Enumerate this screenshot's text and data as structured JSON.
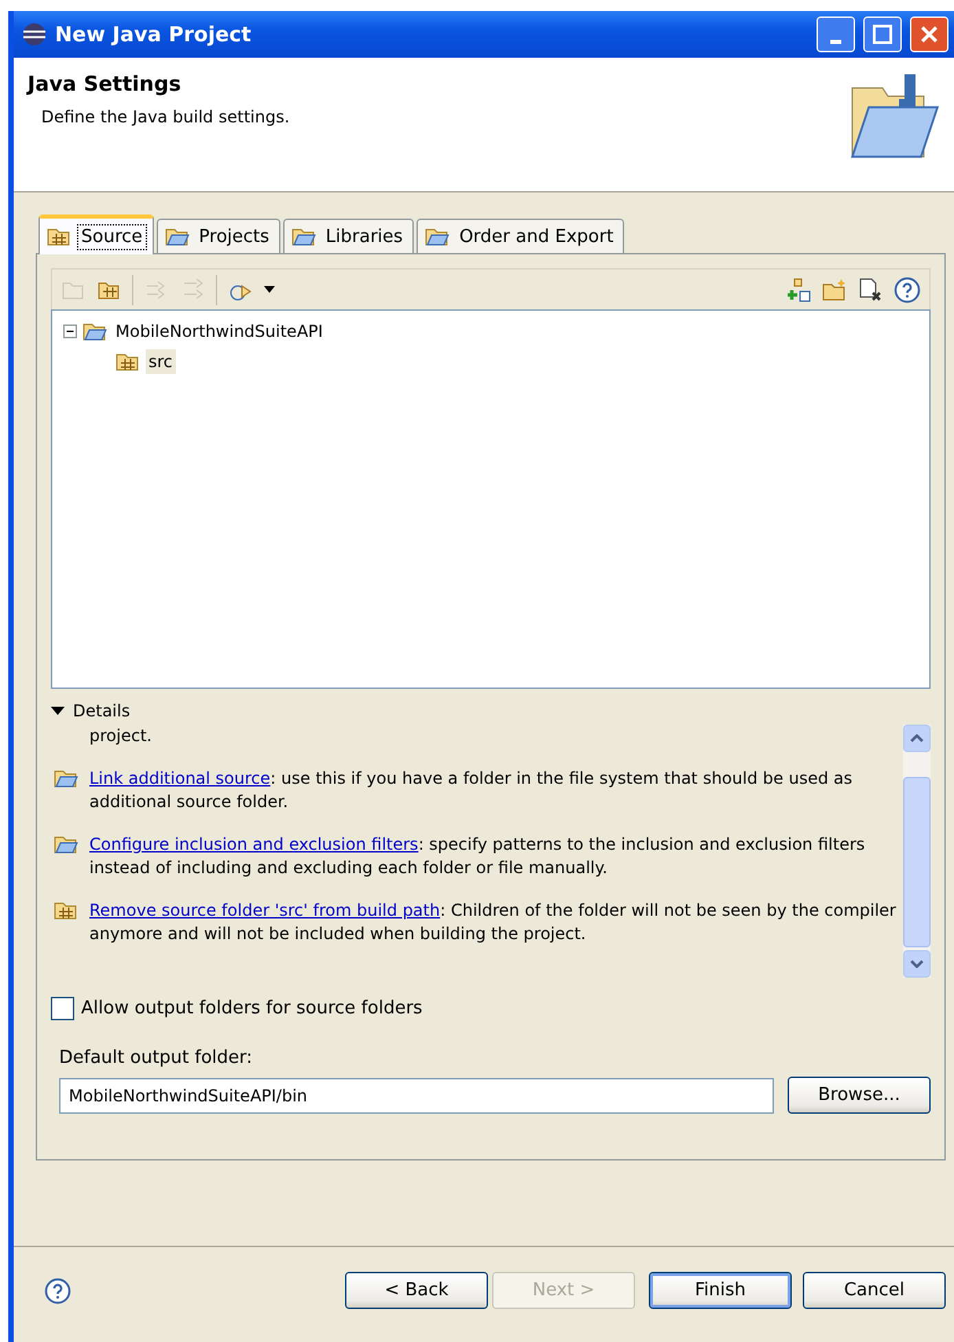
{
  "window": {
    "title": "New Java Project"
  },
  "header": {
    "title": "Java Settings",
    "description": "Define the Java build settings."
  },
  "tabs": [
    {
      "label": "Source",
      "selected": true
    },
    {
      "label": "Projects",
      "selected": false
    },
    {
      "label": "Libraries",
      "selected": false
    },
    {
      "label": "Order and Export",
      "selected": false
    }
  ],
  "toolbar": [
    {
      "disabled": true
    },
    {
      "disabled": false
    },
    {
      "disabled": true
    },
    {
      "disabled": true
    },
    {
      "disabled": false
    }
  ],
  "tree": [
    {
      "label": "MobileNorthwindSuiteAPI",
      "expanded": true,
      "children": [
        {
          "label": "src",
          "selected": true
        }
      ]
    }
  ],
  "details": {
    "label": "Details",
    "expanded": true,
    "items": [
      {
        "kind": "continuation",
        "text": "project."
      },
      {
        "kind": "link",
        "link": "Link additional source",
        "text": ": use this if you have a folder in the file system that should be used as additional source folder."
      },
      {
        "kind": "link",
        "link": "Configure inclusion and exclusion filters",
        "text": ": specify patterns to the inclusion and exclusion filters instead of including and excluding each folder or file manually."
      },
      {
        "kind": "link",
        "link": "Remove source folder 'src' from build path",
        "text": ": Children of the folder will not be seen by the compiler anymore and will not be included when building the project."
      }
    ]
  },
  "allow_output": {
    "label": "Allow output folders for source folders",
    "checked": false
  },
  "default_output": {
    "label": "Default output folder:",
    "value": "MobileNorthwindSuiteAPI/bin",
    "browse": "Browse..."
  },
  "buttons": [
    {
      "label": "< Back",
      "disabled": false,
      "default": false
    },
    {
      "label": "Next >",
      "disabled": true,
      "default": false
    },
    {
      "label": "Finish",
      "disabled": false,
      "default": true
    },
    {
      "label": "Cancel",
      "disabled": false,
      "default": false
    }
  ]
}
